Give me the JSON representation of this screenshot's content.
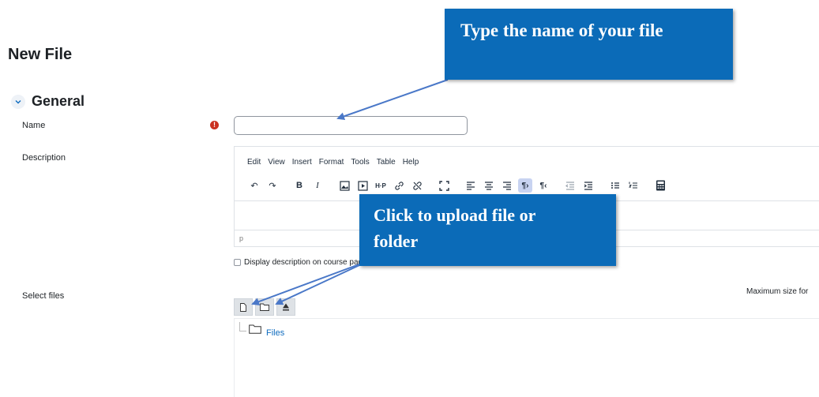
{
  "page": {
    "title": "New File"
  },
  "section": {
    "title": "General"
  },
  "fields": {
    "name_label": "Name",
    "required_icon": "!",
    "name_value": "",
    "description_label": "Description",
    "select_files_label": "Select files"
  },
  "editor": {
    "menu": [
      "Edit",
      "View",
      "Insert",
      "Format",
      "Tools",
      "Table",
      "Help"
    ],
    "toolbar_icons": [
      "undo-icon",
      "redo-icon",
      "bold-icon",
      "italic-icon",
      "image-icon",
      "media-icon",
      "h5p-icon",
      "link-icon",
      "unlink-icon",
      "fullscreen-icon",
      "align-left-icon",
      "align-center-icon",
      "align-right-icon",
      "ltr-icon",
      "rtl-icon",
      "outdent-icon",
      "indent-icon",
      "bullet-list-icon",
      "numbered-list-icon",
      "calculator-icon"
    ],
    "status_path": "p"
  },
  "display_description": {
    "label": "Display description on course page",
    "checked": false
  },
  "filemanager": {
    "max_size_text": "Maximum size for",
    "buttons": [
      "add-file-icon",
      "create-folder-icon",
      "download-icon"
    ],
    "folder_label": "Files"
  },
  "callouts": {
    "name_hint": "Type the name of your file",
    "upload_hint_line1": "Click to upload file or",
    "upload_hint_line2": "folder"
  },
  "colors": {
    "callout_bg": "#0b6bb8",
    "link": "#0f6cbf",
    "required": "#ca3120",
    "arrow": "#4a78c8"
  }
}
